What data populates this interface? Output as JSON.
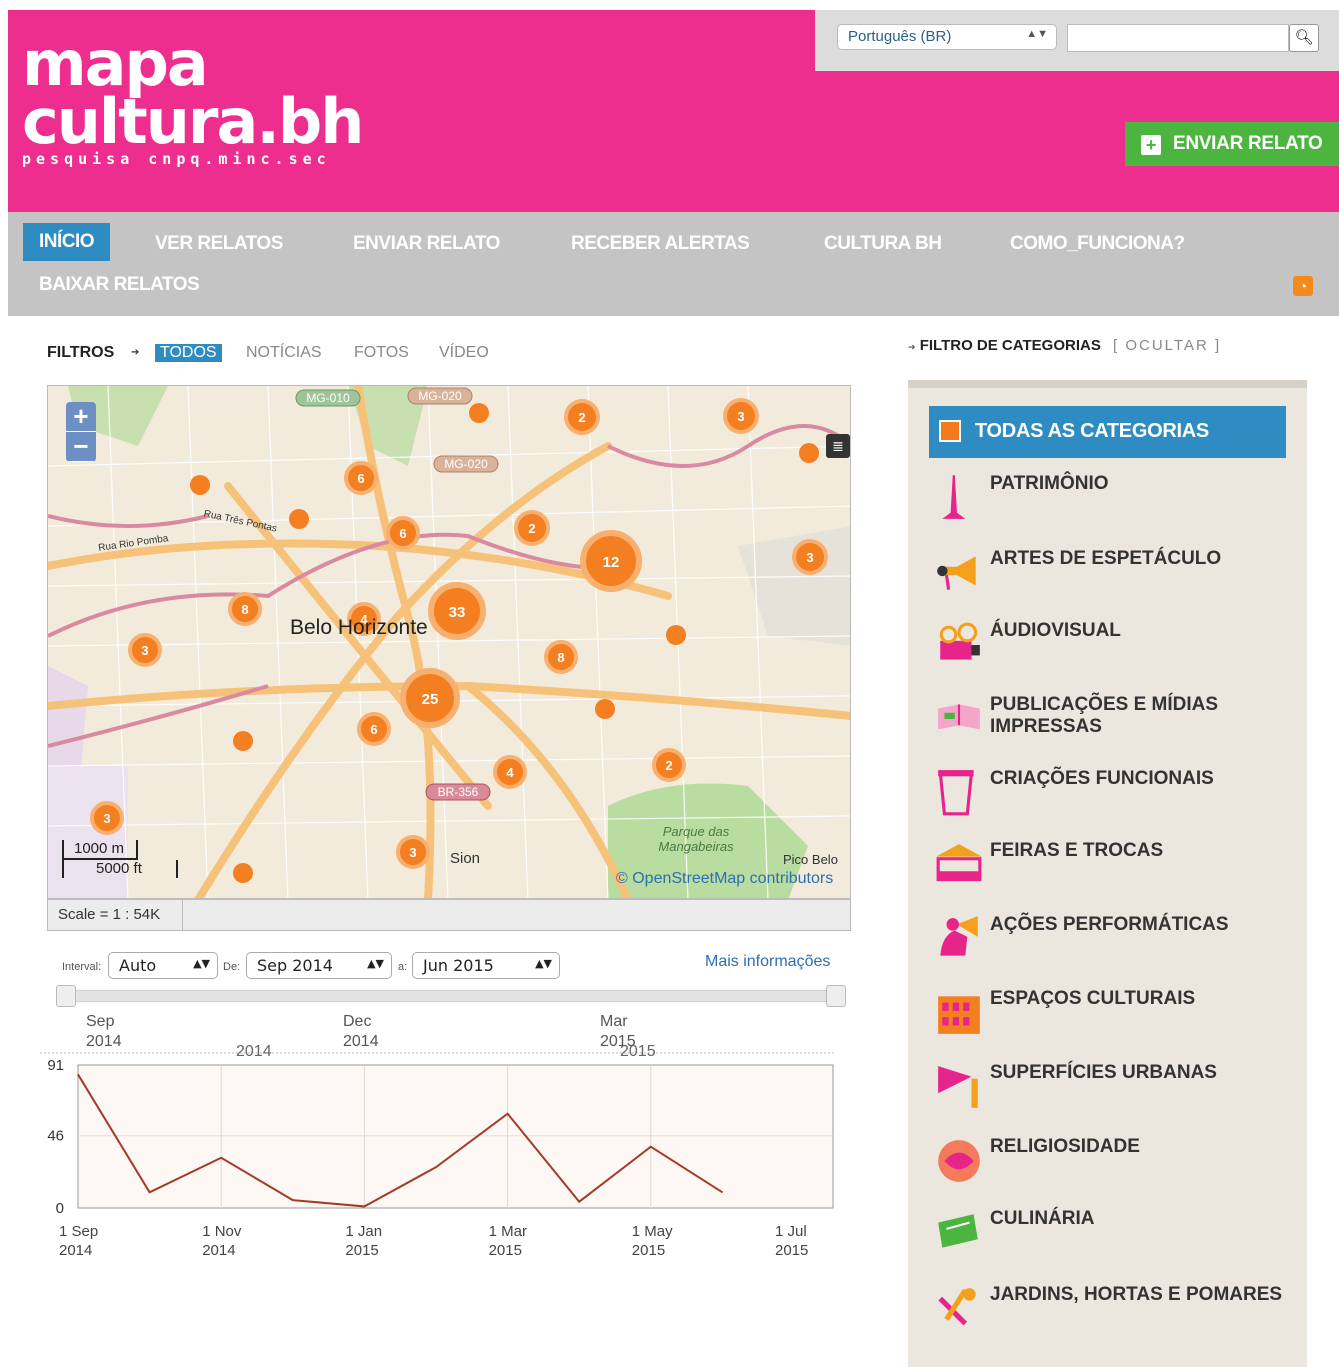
{
  "header": {
    "logo_line1": "mapa",
    "logo_line2": "cultura.bh",
    "logo_line3": "pesquisa cnpq.minc.sec",
    "language": "Português (BR)",
    "search_placeholder": "",
    "send_button": "ENVIAR RELATO",
    "brand_color": "#ee2e8f"
  },
  "nav": {
    "items": [
      "INÍCIO",
      "VER RELATOS",
      "ENVIAR RELATO",
      "RECEBER ALERTAS",
      "CULTURA BH",
      "COMO_FUNCIONA?",
      "BAIXAR RELATOS"
    ],
    "active": "INÍCIO"
  },
  "filters": {
    "label": "FILTROS",
    "items": [
      "TODOS",
      "NOTÍCIAS",
      "FOTOS",
      "VÍDEO"
    ],
    "active": "TODOS"
  },
  "map": {
    "city": "Belo Horizonte",
    "attribution": "© OpenStreetMap contributors",
    "scale_text": "Scale = 1 : 54K",
    "scale_m": "1000 m",
    "scale_ft": "5000 ft",
    "road_labels": [
      "MG-010",
      "MG-020",
      "MG-020",
      "BR-356"
    ],
    "place_labels": [
      "Sion",
      "Parque das Mangabeiras",
      "Pico Belo",
      "Rua Rio Pomba",
      "Rua Três Pontas"
    ],
    "clusters": [
      "2",
      "3",
      "6",
      "6",
      "2",
      "12",
      "3",
      "8",
      "4",
      "33",
      "3",
      "8",
      "25",
      "6",
      "4",
      "2",
      "3",
      "3"
    ]
  },
  "timeline": {
    "interval_label": "Interval:",
    "interval": "Auto",
    "from_label": "De:",
    "from": "Sep 2014",
    "to_label": "a:",
    "to": "Jun 2015",
    "more_info": "Mais informações",
    "band_top": [
      "Sep 2014",
      "Dec 2014",
      "Mar 2015"
    ],
    "band_years": [
      "2014",
      "2015"
    ]
  },
  "chart_data": {
    "type": "line",
    "x": [
      "2014-09-01",
      "2014-10-01",
      "2014-11-01",
      "2014-12-01",
      "2015-01-01",
      "2015-02-01",
      "2015-03-01",
      "2015-04-01",
      "2015-05-01",
      "2015-06-01"
    ],
    "values": [
      85,
      10,
      32,
      5,
      1,
      26,
      60,
      4,
      39,
      10
    ],
    "ylim": [
      0,
      91
    ],
    "yticks": [
      "91",
      "46",
      "0"
    ],
    "xtick_labels": [
      "1 Sep 2014",
      "1 Nov 2014",
      "1 Jan 2015",
      "1 Mar 2015",
      "1 May 2015",
      "1 Jul 2015"
    ],
    "line_color": "#a33a2a",
    "grid": true
  },
  "categories": {
    "header": "FILTRO DE CATEGORIAS",
    "hide_label": "[ OCULTAR ]",
    "all": "TODAS AS CATEGORIAS",
    "items": [
      {
        "label": "PATRIMÔNIO",
        "icon": "monument-icon"
      },
      {
        "label": "ARTES DE ESPETÁCULO",
        "icon": "megaphone-icon"
      },
      {
        "label": "ÁUDIOVISUAL",
        "icon": "projector-icon"
      },
      {
        "label": "PUBLICAÇÕES E MÍDIAS IMPRESSAS",
        "icon": "book-icon"
      },
      {
        "label": "CRIAÇÕES FUNCIONAIS",
        "icon": "cup-icon"
      },
      {
        "label": "FEIRAS E TROCAS",
        "icon": "market-stall-icon"
      },
      {
        "label": "AÇÕES PERFORMÁTICAS",
        "icon": "performer-icon"
      },
      {
        "label": "ESPAÇOS CULTURAIS",
        "icon": "building-icon"
      },
      {
        "label": "SUPERFÍCIES URBANAS",
        "icon": "flag-icon"
      },
      {
        "label": "RELIGIOSIDADE",
        "icon": "hands-icon"
      },
      {
        "label": "CULINÁRIA",
        "icon": "food-icon"
      },
      {
        "label": "JARDINS, HORTAS E POMARES",
        "icon": "garden-tools-icon"
      }
    ]
  }
}
